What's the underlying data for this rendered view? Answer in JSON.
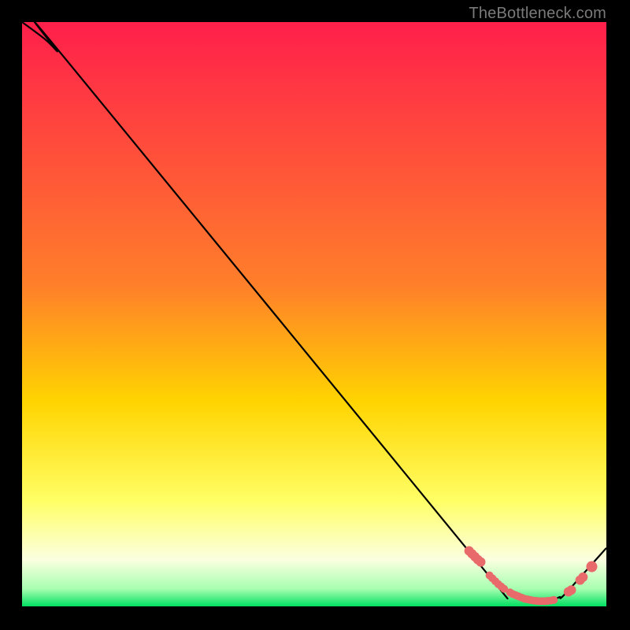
{
  "attribution": "TheBottleneck.com",
  "colors": {
    "page_bg": "#000000",
    "curve": "#000000",
    "marker": "#e86a6a",
    "gradient_top": "#ff1f4b",
    "gradient_mid_upper": "#ff7f2a",
    "gradient_mid": "#ffd400",
    "gradient_mid_lower": "#ffff66",
    "gradient_pale": "#fbffe0",
    "gradient_bottom": "#00e060"
  },
  "chart_data": {
    "type": "line",
    "title": "",
    "xlabel": "",
    "ylabel": "",
    "xlim": [
      0,
      100
    ],
    "ylim": [
      0,
      100
    ],
    "series": [
      {
        "name": "bottleneck-curve",
        "x": [
          0,
          4,
          6,
          8,
          76,
          81,
          83,
          85,
          86,
          87,
          88,
          89,
          90,
          91,
          92,
          93,
          100
        ],
        "y": [
          100,
          97,
          95,
          93,
          10,
          4,
          2.5,
          1.5,
          1.2,
          1.0,
          0.9,
          0.9,
          1.0,
          1.2,
          1.6,
          2.2,
          10
        ]
      }
    ],
    "markers": {
      "name": "data-points",
      "x": [
        76.5,
        77.0,
        77.5,
        78.0,
        78.5,
        80.0,
        80.5,
        81.0,
        81.5,
        82.0,
        82.5,
        83.5,
        84.0,
        84.5,
        85.0,
        85.5,
        86.0,
        86.5,
        87.0,
        87.5,
        88.0,
        88.5,
        89.0,
        89.5,
        90.0,
        90.5,
        91.0,
        93.5,
        94.0,
        95.5,
        96.0,
        97.5
      ],
      "y": [
        9.5,
        9.0,
        8.5,
        8.0,
        7.6,
        5.3,
        4.8,
        4.3,
        3.8,
        3.4,
        3.0,
        2.4,
        2.1,
        1.9,
        1.7,
        1.5,
        1.3,
        1.2,
        1.1,
        1.0,
        0.95,
        0.9,
        0.9,
        0.9,
        0.95,
        1.0,
        1.1,
        2.5,
        2.8,
        4.5,
        5.0,
        6.8
      ],
      "r": [
        6,
        6,
        6,
        6,
        6,
        5,
        5,
        5,
        5,
        5,
        5,
        5,
        5,
        5,
        5,
        5,
        5,
        5,
        5,
        5,
        5,
        5,
        5,
        5,
        5,
        5,
        5,
        6,
        6,
        6,
        6,
        7
      ]
    },
    "gradient_bands": [
      {
        "y": 100,
        "color": "#ff1f4b"
      },
      {
        "y": 55,
        "color": "#ff7f2a"
      },
      {
        "y": 35,
        "color": "#ffd400"
      },
      {
        "y": 18,
        "color": "#ffff66"
      },
      {
        "y": 8,
        "color": "#fbffe0"
      },
      {
        "y": 3,
        "color": "#a7ffb0"
      },
      {
        "y": 0,
        "color": "#00e060"
      }
    ]
  }
}
